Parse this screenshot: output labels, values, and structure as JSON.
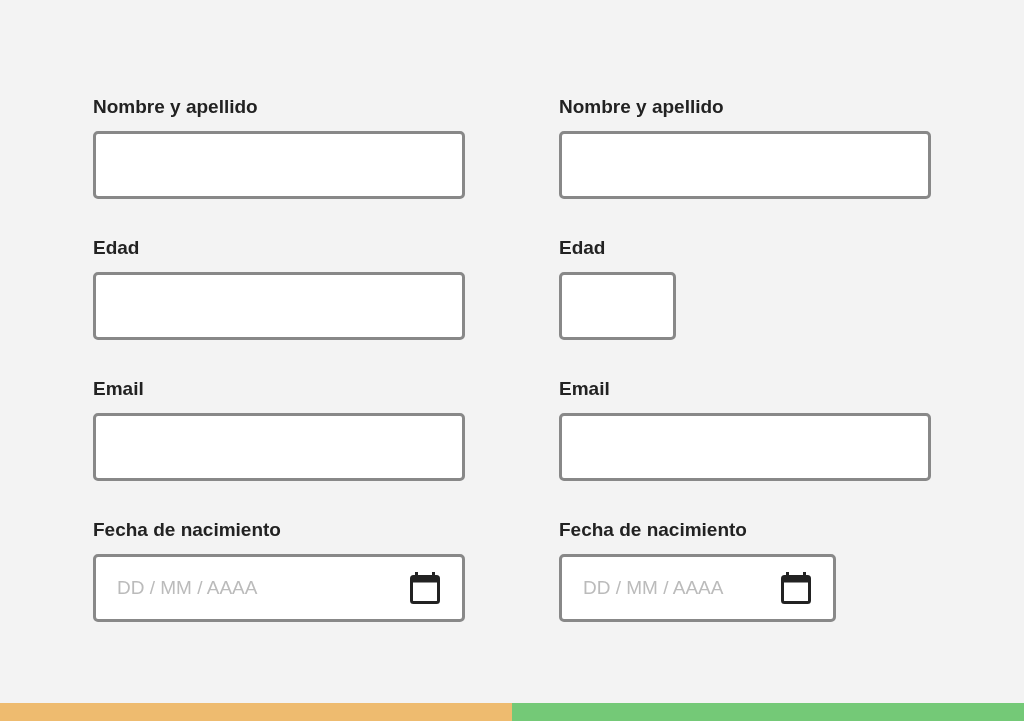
{
  "forms": [
    {
      "color": "#eebb6f",
      "fitted_widths": false,
      "fields": [
        {
          "label": "Nombre y apellido",
          "kind": "text"
        },
        {
          "label": "Edad",
          "kind": "number"
        },
        {
          "label": "Email",
          "kind": "text"
        },
        {
          "label": "Fecha de nacimiento",
          "kind": "date",
          "placeholder": "DD / MM / AAAA"
        }
      ]
    },
    {
      "color": "#74c977",
      "fitted_widths": true,
      "fields": [
        {
          "label": "Nombre y apellido",
          "kind": "text"
        },
        {
          "label": "Edad",
          "kind": "number"
        },
        {
          "label": "Email",
          "kind": "text"
        },
        {
          "label": "Fecha de nacimiento",
          "kind": "date",
          "placeholder": "DD / MM / AAAA"
        }
      ]
    }
  ]
}
